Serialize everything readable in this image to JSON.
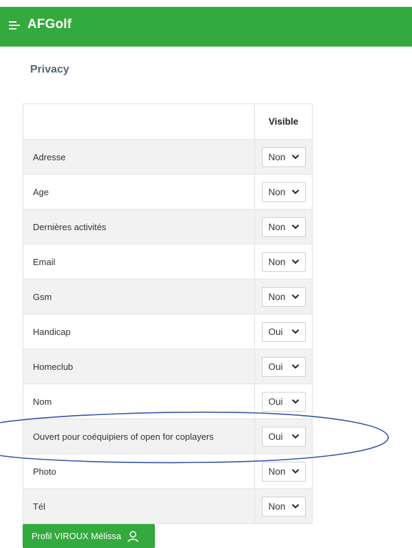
{
  "app": {
    "title": "AFGolf"
  },
  "page": {
    "title": "Privacy"
  },
  "table": {
    "columns": [
      "",
      "Visible"
    ],
    "rows": [
      {
        "label": "Adresse",
        "value": "Non"
      },
      {
        "label": "Age",
        "value": "Non"
      },
      {
        "label": "Dernières activités",
        "value": "Non"
      },
      {
        "label": "Email",
        "value": "Non"
      },
      {
        "label": "Gsm",
        "value": "Non"
      },
      {
        "label": "Handicap",
        "value": "Oui"
      },
      {
        "label": "Homeclub",
        "value": "Oui"
      },
      {
        "label": "Nom",
        "value": "Oui"
      },
      {
        "label": "Ouvert pour coéquipiers of open for coplayers",
        "value": "Oui"
      },
      {
        "label": "Photo",
        "value": "Non"
      },
      {
        "label": "Tél",
        "value": "Non"
      }
    ]
  },
  "profile_button": {
    "label": "Profil VIROUX Mélissa"
  },
  "colors": {
    "brand": "#34a93e",
    "annotation": "#2f55a4"
  },
  "icons": {
    "menu": "hamburger-menu-icon",
    "chevron": "chevron-down-icon",
    "user": "user-icon"
  }
}
